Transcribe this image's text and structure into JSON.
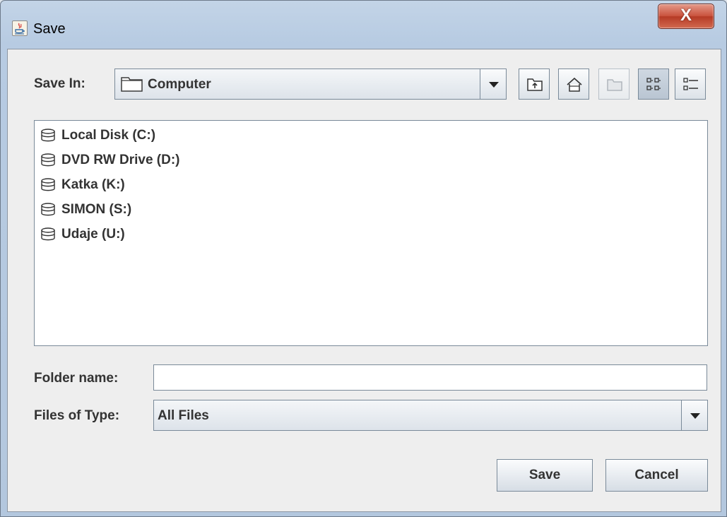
{
  "window": {
    "title": "Save",
    "close_label": "X"
  },
  "toolbar": {
    "save_in_label": "Save In:",
    "save_in_value": "Computer",
    "buttons": [
      {
        "icon": "up-one-level-icon",
        "enabled": true
      },
      {
        "icon": "home-icon",
        "enabled": true
      },
      {
        "icon": "new-folder-icon",
        "enabled": false
      },
      {
        "icon": "list-view-icon",
        "enabled": true,
        "selected": true
      },
      {
        "icon": "details-view-icon",
        "enabled": true
      }
    ]
  },
  "files": [
    {
      "icon": "drive-icon",
      "name": "Local Disk (C:)"
    },
    {
      "icon": "drive-icon",
      "name": "DVD RW Drive (D:)"
    },
    {
      "icon": "drive-icon",
      "name": "Katka (K:)"
    },
    {
      "icon": "drive-icon",
      "name": "SIMON (S:)"
    },
    {
      "icon": "drive-icon",
      "name": "Udaje (U:)"
    }
  ],
  "form": {
    "folder_name_label": "Folder name:",
    "folder_name_value": "",
    "files_of_type_label": "Files of Type:",
    "files_of_type_value": "All Files"
  },
  "buttons": {
    "save_label": "Save",
    "cancel_label": "Cancel"
  }
}
